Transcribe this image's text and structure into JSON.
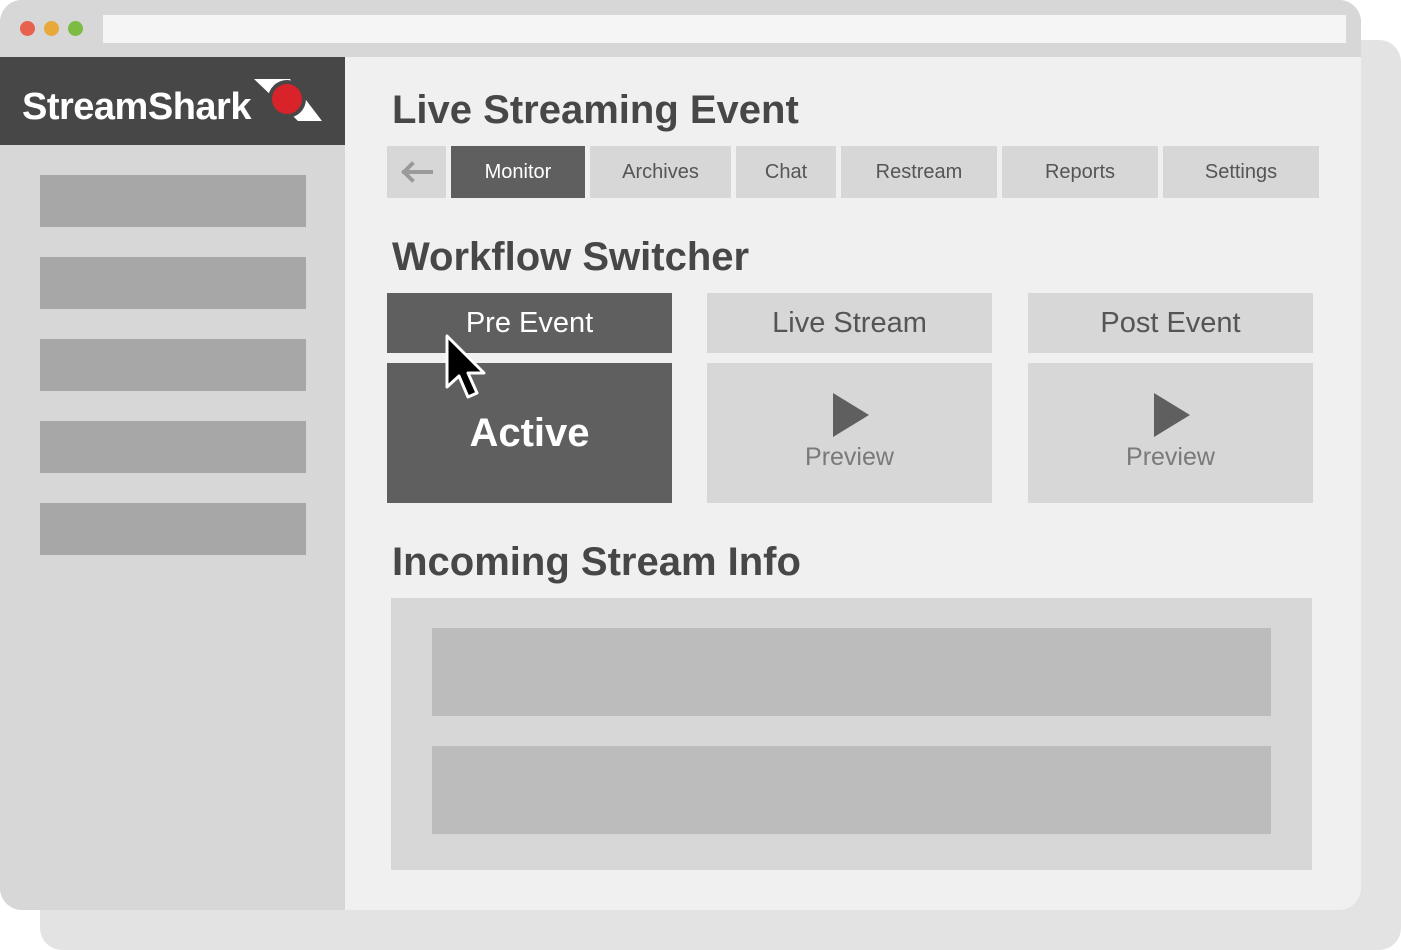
{
  "colors": {
    "dot_red": "#e8614f",
    "dot_yellow": "#e6a93a",
    "dot_green": "#7dbc42",
    "logo_red": "#d8232a",
    "dark": "#474747",
    "active": "#5f5f5f"
  },
  "brand": {
    "name": "StreamShark",
    "mark_icon": "shark-fin-record-icon"
  },
  "sidebar": {
    "items": [
      {},
      {},
      {},
      {},
      {}
    ]
  },
  "page": {
    "title": "Live Streaming Event"
  },
  "tabs": {
    "back_icon": "arrow-left-icon",
    "items": [
      {
        "label": "Monitor",
        "active": true
      },
      {
        "label": "Archives",
        "active": false
      },
      {
        "label": "Chat",
        "active": false
      },
      {
        "label": "Restream",
        "active": false
      },
      {
        "label": "Reports",
        "active": false
      },
      {
        "label": "Settings",
        "active": false
      }
    ]
  },
  "workflow": {
    "title": "Workflow Switcher",
    "stages": [
      {
        "label": "Pre Event",
        "status": "Active",
        "active": true
      },
      {
        "label": "Live Stream",
        "status": "Preview",
        "active": false,
        "icon": "play-icon"
      },
      {
        "label": "Post Event",
        "status": "Preview",
        "active": false,
        "icon": "play-icon"
      }
    ]
  },
  "incoming": {
    "title": "Incoming Stream Info"
  },
  "cursor_icon": "mouse-pointer-icon"
}
